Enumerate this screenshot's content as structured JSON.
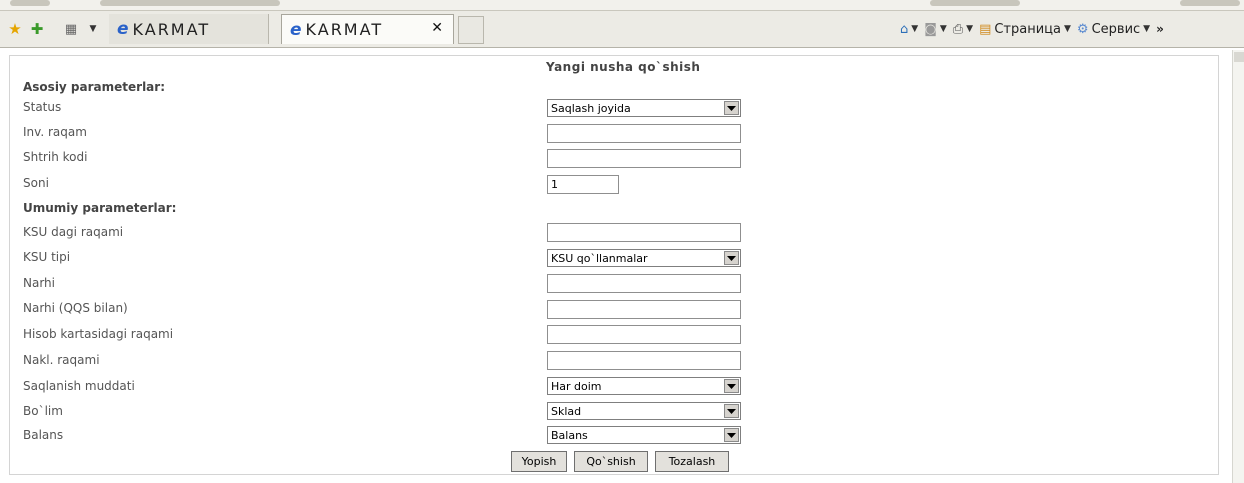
{
  "browser": {
    "tabs": [
      {
        "label": "KARMAT",
        "active": false
      },
      {
        "label": "KARMAT",
        "active": true
      }
    ],
    "toolbar": {
      "page_label": "Страница",
      "service_label": "Сервис"
    }
  },
  "form": {
    "title": "Yangi nusha qo`shish",
    "main_section": "Asosiy parameterlar:",
    "general_section": "Umumiy parameterlar:",
    "fields": {
      "status": {
        "label": "Status",
        "value": "Saqlash joyida"
      },
      "inv": {
        "label": "Inv. raqam",
        "value": ""
      },
      "barcode": {
        "label": "Shtrih kodi",
        "value": ""
      },
      "count": {
        "label": "Soni",
        "value": "1"
      },
      "ksu_number": {
        "label": "KSU dagi raqami",
        "value": ""
      },
      "ksu_type": {
        "label": "KSU tipi",
        "value": "KSU qo`llanmalar"
      },
      "price": {
        "label": "Narhi",
        "value": ""
      },
      "price_vat": {
        "label": "Narhi (QQS bilan)",
        "value": ""
      },
      "account_card": {
        "label": "Hisob kartasidagi raqami",
        "value": ""
      },
      "invoice": {
        "label": "Nakl. raqami",
        "value": ""
      },
      "storage_period": {
        "label": "Saqlanish muddati",
        "value": "Har doim"
      },
      "department": {
        "label": "Bo`lim",
        "value": "Sklad"
      },
      "balance": {
        "label": "Balans",
        "value": "Balans"
      }
    },
    "buttons": {
      "close": "Yopish",
      "add": "Qo`shish",
      "clear": "Tozalash"
    }
  }
}
